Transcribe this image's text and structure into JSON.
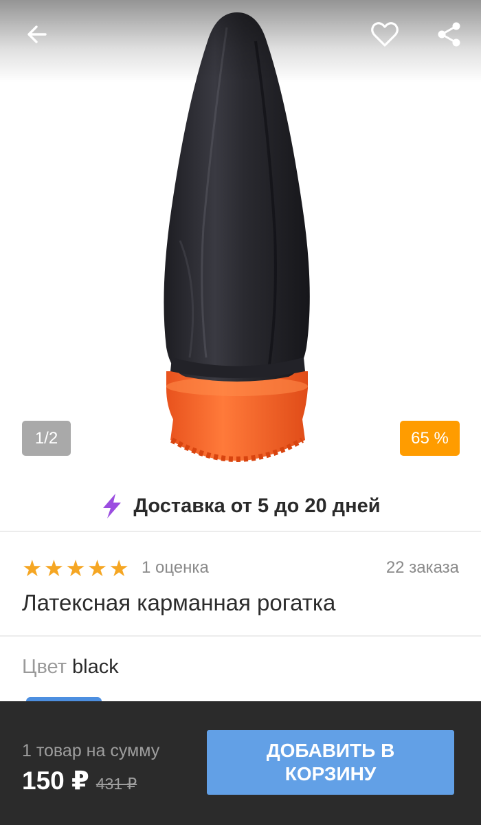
{
  "gallery": {
    "counter": "1/2",
    "discount": "65 %"
  },
  "icons": {
    "back": "arrow-left-icon",
    "favorite": "heart-outline-icon",
    "share": "share-icon",
    "delivery": "lightning-icon"
  },
  "delivery": {
    "text": "Доставка от 5 до 20 дней"
  },
  "rating": {
    "stars": 5,
    "count_label": "1 оценка",
    "orders_label": "22 заказа"
  },
  "product": {
    "title": "Латексная карманная рогатка"
  },
  "variant": {
    "label": "Цвет",
    "value": "black"
  },
  "cart_bar": {
    "summary_label": "1 товар на сумму",
    "price": "150 ₽",
    "old_price": "431 ₽",
    "button_label": "ДОБАВИТЬ В КОРЗИНУ"
  },
  "colors": {
    "discount_badge": "#ff9c00",
    "counter_badge": "#a9a9a9",
    "star": "#f5a623",
    "button": "#62a0e6",
    "bottom_bar": "#2b2b2b",
    "lightning": "#9b4de0"
  }
}
